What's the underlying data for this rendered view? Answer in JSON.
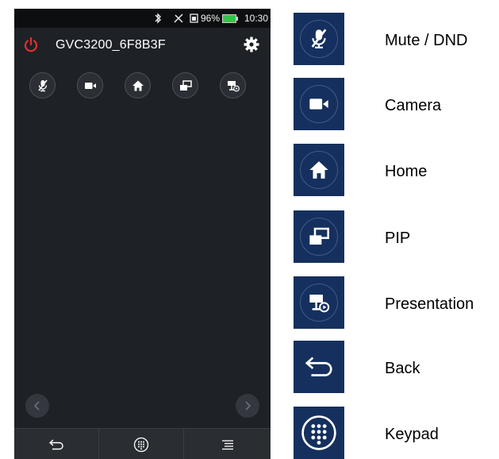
{
  "status_bar": {
    "battery_percent": "96%",
    "time": "10:30"
  },
  "header": {
    "device_name": "GVC3200_6F8B3F"
  },
  "toolbar_icons": [
    "mute-dnd-icon",
    "camera-icon",
    "home-icon",
    "pip-icon",
    "presentation-icon"
  ],
  "bottom_bar_icons": [
    "back-icon",
    "keypad-icon",
    "menu-icon"
  ],
  "legend": {
    "mute": "Mute / DND",
    "camera": "Camera",
    "home": "Home",
    "pip": "PIP",
    "presentation": "Presentation",
    "back": "Back",
    "keypad": "Keypad"
  },
  "colors": {
    "power_red": "#e0312f",
    "legend_tile": "#15305e",
    "phone_bg": "#1e2126"
  }
}
